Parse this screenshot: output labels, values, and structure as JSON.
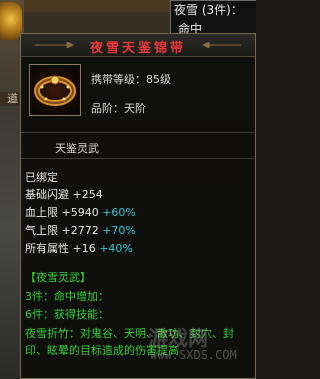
{
  "background": {
    "side_label": "道",
    "right_panel": {
      "title": "夜雪 (3件)：",
      "subtitle": "命中"
    }
  },
  "tooltip": {
    "title": "夜雪天鉴锦带",
    "carry_level": "携带等级：85级",
    "grade": "品阶：天阶",
    "item_type": "天鉴灵武",
    "bound": "已绑定",
    "attributes": [
      {
        "name": "基础闪避",
        "value": "+254",
        "pct": ""
      },
      {
        "name": "血上限",
        "value": "+5940",
        "pct": "+60%"
      },
      {
        "name": "气上限",
        "value": "+2772",
        "pct": "+70%"
      },
      {
        "name": "所有属性",
        "value": "+16",
        "pct": "+40%"
      }
    ],
    "set": {
      "name": "【夜雪灵武】",
      "piece3": "3件：命中增加：",
      "piece6": "6件：获得技能：",
      "skill": "夜雪折竹：对鬼谷、天明、散功、封穴、封印、眩晕的目标造成的伤害提高"
    },
    "icon": "belt-icon"
  },
  "watermark": {
    "text": "游戏网",
    "url": "www.SXDS.COM"
  },
  "colors": {
    "title": "#e8383a",
    "set_green": "#38d038",
    "percent_cyan": "#38c8d8"
  }
}
